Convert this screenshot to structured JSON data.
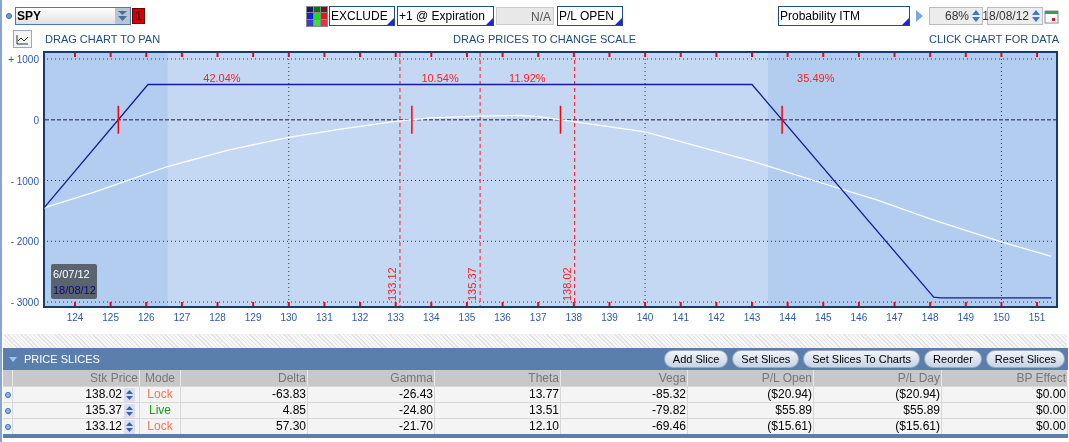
{
  "toolbar": {
    "symbol": "SPY",
    "badge": "1",
    "filters": [
      {
        "value": "EXCLUDE"
      },
      {
        "value": "+1 @ Expiration"
      }
    ],
    "na": "N/A",
    "pl_mode": "P/L OPEN",
    "probability": "Probability ITM",
    "percent": "68%",
    "date": "18/08/12"
  },
  "hints": [
    "DRAG CHART TO PAN",
    "DRAG PRICES TO CHANGE SCALE",
    "CLICK CHART FOR DATA"
  ],
  "chart": {
    "chart_data": {
      "type": "line",
      "grid": true,
      "xlim": [
        123.13,
        151.56
      ],
      "ylim": [
        -3082,
        1115
      ],
      "xticks": [
        124,
        125,
        126,
        127,
        128,
        129,
        130,
        131,
        132,
        133,
        134,
        135,
        136,
        137,
        138,
        139,
        140,
        141,
        142,
        143,
        144,
        145,
        146,
        147,
        148,
        149,
        150,
        151
      ],
      "yticks": [
        {
          "value": 1000,
          "label": "+ 1000"
        },
        0,
        {
          "value": -1000,
          "label": "- 1000"
        },
        {
          "value": -2000,
          "label": "- 2000"
        },
        {
          "value": -3000,
          "label": "- 3000"
        }
      ],
      "series": [
        {
          "name": "6/07/12",
          "color": "#ffffff",
          "x": [
            123.13,
            124.5,
            126.6,
            128.3,
            130,
            131.5,
            133,
            134,
            135.4,
            136.5,
            137,
            138,
            140,
            143,
            145,
            146.5,
            148,
            150,
            151.4
          ],
          "values": [
            -1450,
            -1200,
            -770,
            -500,
            -290,
            -150,
            -25,
            30,
            60,
            70,
            50,
            -30,
            -200,
            -680,
            -1050,
            -1320,
            -1630,
            -2010,
            -2250
          ]
        },
        {
          "name": "18/08/12",
          "color": "#1a1aa0",
          "x": [
            123.13,
            126.05,
            143.0,
            148.1,
            148.3,
            151.4
          ],
          "values": [
            -1450,
            580,
            580,
            -2920,
            -2930,
            -2930
          ]
        }
      ],
      "ref_lines": [
        {
          "axis": "y",
          "value": 0
        },
        {
          "axis": "x",
          "value": 133.12,
          "label": "133.12"
        },
        {
          "axis": "x",
          "value": 135.37,
          "label": "135.37"
        },
        {
          "axis": "x",
          "value": 138.02,
          "label": "138.02"
        }
      ],
      "bands": [
        {
          "axis": "x",
          "from": 123.13,
          "to": 126.6
        },
        {
          "axis": "x",
          "from": 143.45,
          "to": 151.56
        }
      ],
      "annotations": [
        "42.04%",
        "10.54%",
        "11.92%",
        "35.49%"
      ]
    }
  },
  "price_slices": {
    "title": "PRICE SLICES",
    "expanded": true,
    "buttons": [
      "Add Slice",
      "Set Slices",
      "Set Slices To Charts",
      "Reorder",
      "Reset Slices"
    ],
    "columns": [
      "Stk Price",
      "Mode",
      "Delta",
      "Gamma",
      "Theta",
      "Vega",
      "P/L Open",
      "P/L Day",
      "BP Effect"
    ],
    "rows": [
      {
        "stk_price": "138.02",
        "mode": "Lock",
        "kind": "lock",
        "delta": "-63.83",
        "gamma": "-26.43",
        "theta": "13.77",
        "vega": "-85.32",
        "pl_open": "($20.94)",
        "pl_day": "($20.94)",
        "bp_effect": "$0.00"
      },
      {
        "stk_price": "135.37",
        "mode": "Live",
        "kind": "live",
        "delta": "4.85",
        "gamma": "-24.80",
        "theta": "13.51",
        "vega": "-79.82",
        "pl_open": "$55.89",
        "pl_day": "$55.89",
        "bp_effect": "$0.00"
      },
      {
        "stk_price": "133.12",
        "mode": "Lock",
        "kind": "lock",
        "delta": "57.30",
        "gamma": "-21.70",
        "theta": "12.10",
        "vega": "-69.46",
        "pl_open": "($15.61)",
        "pl_day": "($15.61)",
        "bp_effect": "$0.00"
      }
    ]
  }
}
